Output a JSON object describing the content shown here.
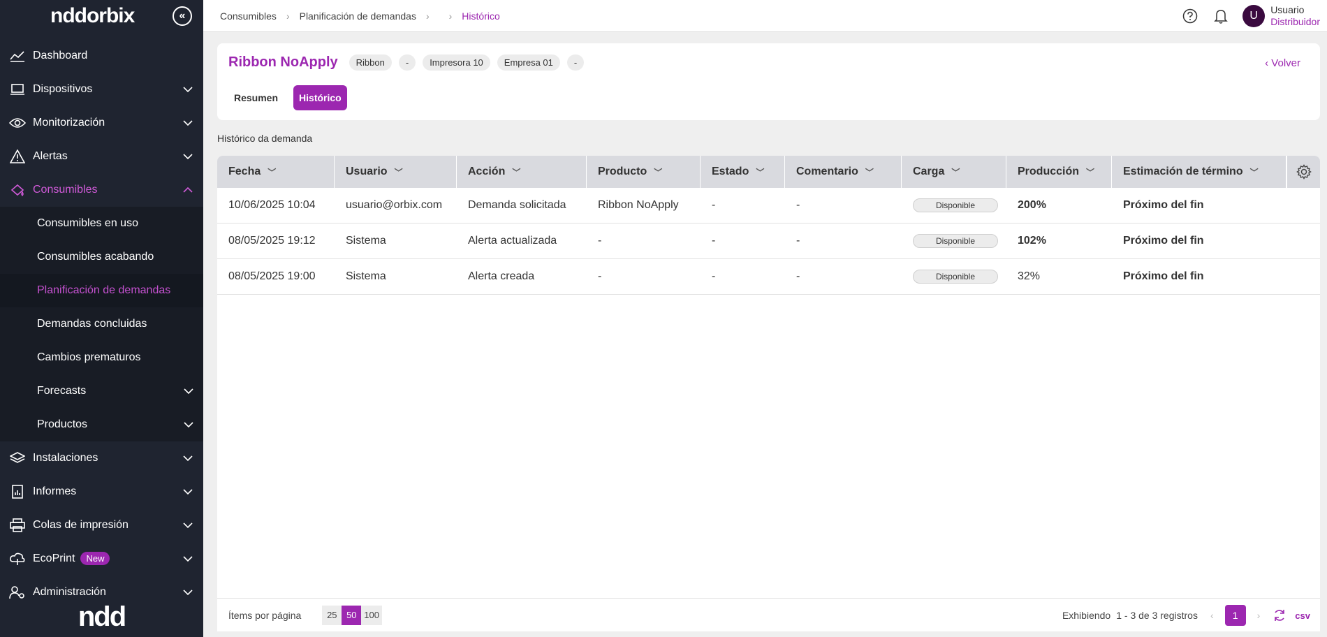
{
  "sidebar": {
    "logo": "nddorbix",
    "bottom_logo": "ndd",
    "items": [
      {
        "label": "Dashboard",
        "icon": "chart-line-icon",
        "expandable": false
      },
      {
        "label": "Dispositivos",
        "icon": "laptop-icon",
        "expandable": true
      },
      {
        "label": "Monitorización",
        "icon": "eye-icon",
        "expandable": true
      },
      {
        "label": "Alertas",
        "icon": "warning-icon",
        "expandable": true
      },
      {
        "label": "Consumibles",
        "icon": "ink-drop-icon",
        "expandable": true,
        "expanded": true
      }
    ],
    "subitems": [
      {
        "label": "Consumibles en uso"
      },
      {
        "label": "Consumibles acabando"
      },
      {
        "label": "Planificación de demandas",
        "active": true
      },
      {
        "label": "Demandas concluidas"
      },
      {
        "label": "Cambios prematuros"
      },
      {
        "label": "Forecasts",
        "expandable": true
      },
      {
        "label": "Productos",
        "expandable": true
      }
    ],
    "items_after": [
      {
        "label": "Instalaciones",
        "icon": "layers-icon"
      },
      {
        "label": "Informes",
        "icon": "report-icon"
      },
      {
        "label": "Colas de impresión",
        "icon": "printer-icon"
      },
      {
        "label": "EcoPrint",
        "icon": "eco-cloud-icon",
        "badge": "New"
      },
      {
        "label": "Administración",
        "icon": "admin-users-icon"
      }
    ]
  },
  "topbar": {
    "breadcrumbs": [
      "Consumibles",
      "Planificación de demandas",
      "",
      "Histórico"
    ],
    "user_initial": "U",
    "user_name": "Usuario",
    "user_role": "Distribuidor"
  },
  "header": {
    "title": "Ribbon NoApply",
    "chips": [
      "Ribbon",
      "-",
      "Impresora 10",
      "Empresa 01",
      "-"
    ],
    "back_label": "Volver",
    "tabs": [
      {
        "label": "Resumen",
        "active": false
      },
      {
        "label": "Histórico",
        "active": true
      }
    ]
  },
  "section_label": "Histórico da demanda",
  "table": {
    "columns": [
      "Fecha",
      "Usuario",
      "Acción",
      "Producto",
      "Estado",
      "Comentario",
      "Carga",
      "Producción",
      "Estimación de término"
    ],
    "rows": [
      {
        "fecha": "10/06/2025 10:04",
        "usuario": "usuario@orbix.com",
        "accion": "Demanda solicitada",
        "producto": "Ribbon NoApply",
        "estado": "-",
        "comentario": "-",
        "carga": "Disponible",
        "produccion": "200%",
        "estimacion": "Próximo del fin"
      },
      {
        "fecha": "08/05/2025 19:12",
        "usuario": "Sistema",
        "accion": "Alerta actualizada",
        "producto": "-",
        "estado": "-",
        "comentario": "-",
        "carga": "Disponible",
        "produccion": "102%",
        "estimacion": "Próximo del fin"
      },
      {
        "fecha": "08/05/2025 19:00",
        "usuario": "Sistema",
        "accion": "Alerta creada",
        "producto": "-",
        "estado": "-",
        "comentario": "-",
        "carga": "Disponible",
        "produccion": "32%",
        "estimacion": "Próximo del fin"
      }
    ]
  },
  "footer": {
    "items_per_page_label": "Ítems por página",
    "page_sizes": [
      "25",
      "50",
      "100"
    ],
    "showing_label": "Exhibiendo",
    "range_text": "1 - 3 de 3 registros",
    "current_page": "1",
    "csv_label": "csv"
  },
  "colors": {
    "accent": "#9c27b0",
    "sidebar_bg": "#1f2430"
  }
}
